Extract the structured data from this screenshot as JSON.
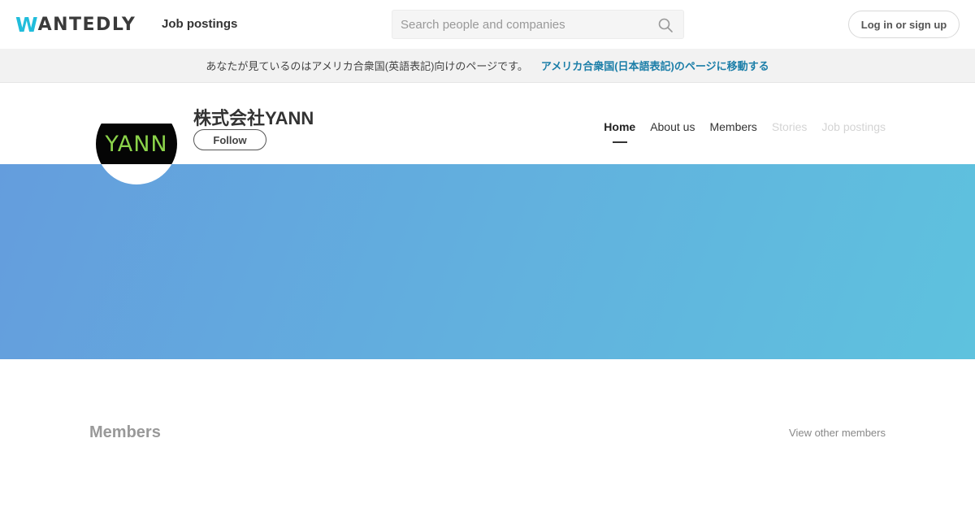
{
  "header": {
    "logo_initial": "W",
    "logo_rest": "ANTEDLY",
    "nav_job_postings": "Job postings",
    "search_placeholder": "Search people and companies",
    "login_label": "Log in or sign up"
  },
  "region_banner": {
    "message": "あなたが見ているのはアメリカ合衆国(英語表記)向けのページです。",
    "link": "アメリカ合衆国(日本語表記)のページに移動する"
  },
  "company": {
    "name": "株式会社YANN",
    "logo_text": "YANN",
    "follow_label": "Follow"
  },
  "tabs": [
    {
      "label": "Home",
      "state": "active"
    },
    {
      "label": "About us",
      "state": "normal"
    },
    {
      "label": "Members",
      "state": "normal"
    },
    {
      "label": "Stories",
      "state": "disabled"
    },
    {
      "label": "Job postings",
      "state": "disabled"
    }
  ],
  "members_section": {
    "title": "Members",
    "view_other": "View other members"
  },
  "colors": {
    "brand_accent": "#21bddb",
    "link": "#1b7ea8",
    "cover_start": "#649ddd",
    "cover_end": "#5ec2de",
    "logo_green": "#8bd34a"
  }
}
